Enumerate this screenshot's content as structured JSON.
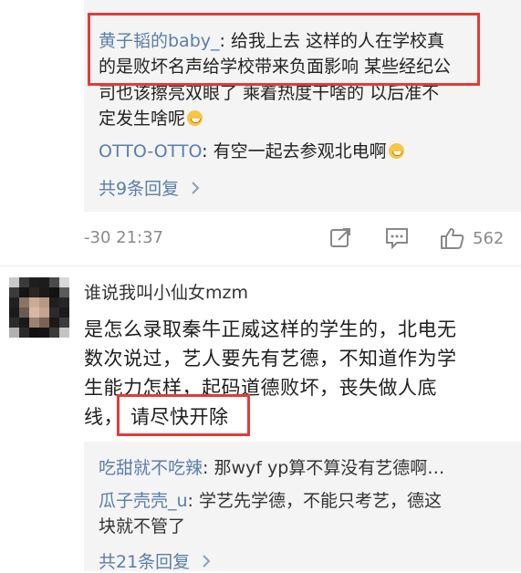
{
  "reply_block_1": {
    "reply_1": {
      "author": "黄子韬的baby_",
      "line_1_text": ": 给我上去 这样的人在学校真",
      "line_2": "的是败坏名声给学校带来负面影响 某些经纪公",
      "line_3": "司也该擦亮双眼了 乘着热度干啥的 以后准不",
      "line_4": "定发生啥呢"
    },
    "reply_2": {
      "author": "OTTO-OTTO",
      "text": ": 有空一起去参观北电啊"
    },
    "more_replies": "共9条回复"
  },
  "comment_meta": {
    "time": "-30 21:37",
    "like_count": "562"
  },
  "comment": {
    "author": "谁说我叫小仙女mzm",
    "line_1": "是怎么录取秦牛正威这样的学生的，北电无",
    "line_2": "数次说过，艺人要先有艺德，不知道作为学",
    "line_3": "生能力怎样，起码道德败坏，丧失做人底",
    "line_4_prefix": "线，",
    "line_4_highlight": "请尽快开除"
  },
  "reply_block_2": {
    "reply_1": {
      "author": "吃甜就不吃辣",
      "text": ": 那wyf yp算不算没有艺德啊…"
    },
    "reply_2": {
      "author": "瓜子壳壳_u",
      "line_1_text": ": 学艺先学德，不能只考艺，德这",
      "line_2": "块就不管了"
    },
    "more_replies": "共21条回复"
  },
  "colors": {
    "link": "#5a7ea8",
    "highlight_box": "#e23b3b",
    "reply_bg": "#f4f4f4",
    "meta": "#8a8a8a"
  },
  "icons": {
    "share": "share-icon",
    "comment": "comment-icon",
    "like": "thumbs-up-icon",
    "more": "chevron-right-icon",
    "emoji": "smile-emoji-icon"
  }
}
